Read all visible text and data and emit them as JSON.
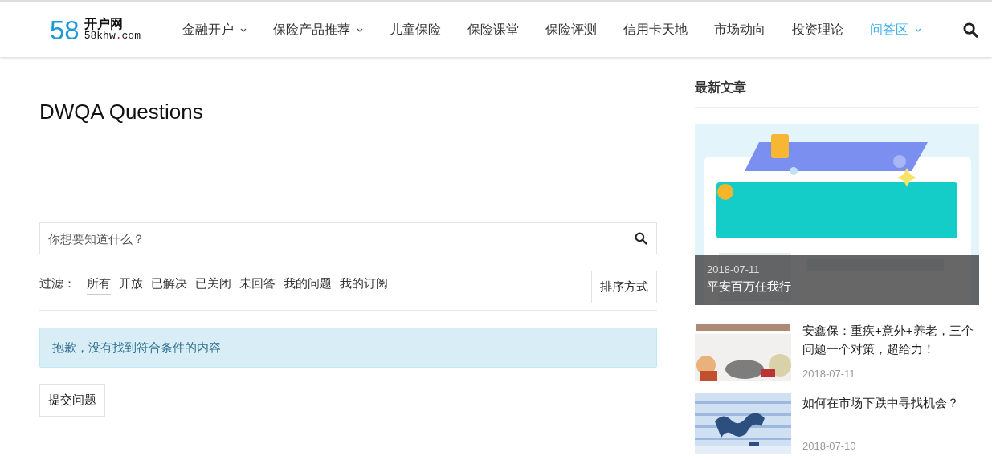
{
  "logo": {
    "number": "58",
    "name": "开户网",
    "domain_start": "58khw",
    "domain_dot": ".",
    "domain_end": "com"
  },
  "nav": [
    {
      "label": "金融开户",
      "dropdown": true,
      "selected": false
    },
    {
      "label": "保险产品推荐",
      "dropdown": true,
      "selected": false
    },
    {
      "label": "儿童保险",
      "dropdown": false,
      "selected": false
    },
    {
      "label": "保险课堂",
      "dropdown": false,
      "selected": false
    },
    {
      "label": "保险评测",
      "dropdown": false,
      "selected": false
    },
    {
      "label": "信用卡天地",
      "dropdown": false,
      "selected": false
    },
    {
      "label": "市场动向",
      "dropdown": false,
      "selected": false
    },
    {
      "label": "投资理论",
      "dropdown": false,
      "selected": false
    },
    {
      "label": "问答区",
      "dropdown": true,
      "selected": true
    }
  ],
  "page_title": "DWQA Questions",
  "search": {
    "placeholder": "你想要知道什么？"
  },
  "filter": {
    "label": "过滤：",
    "items": [
      {
        "label": "所有",
        "selected": true
      },
      {
        "label": "开放",
        "selected": false
      },
      {
        "label": "已解决",
        "selected": false
      },
      {
        "label": "已关闭",
        "selected": false
      },
      {
        "label": "未回答",
        "selected": false
      },
      {
        "label": "我的问题",
        "selected": false
      },
      {
        "label": "我的订阅",
        "selected": false
      }
    ],
    "sort_button": "排序方式"
  },
  "notice": "抱歉，没有找到符合条件的内容",
  "submit_button": "提交问题",
  "sidebar": {
    "heading": "最新文章",
    "featured": {
      "date": "2018-07-11",
      "title": "平安百万任我行"
    },
    "articles": [
      {
        "title": "安鑫保：重疾+意外+养老，三个问题一个对策，超给力！",
        "date": "2018-07-11"
      },
      {
        "title": "如何在市场下跌中寻找机会？",
        "date": "2018-07-10"
      }
    ]
  }
}
